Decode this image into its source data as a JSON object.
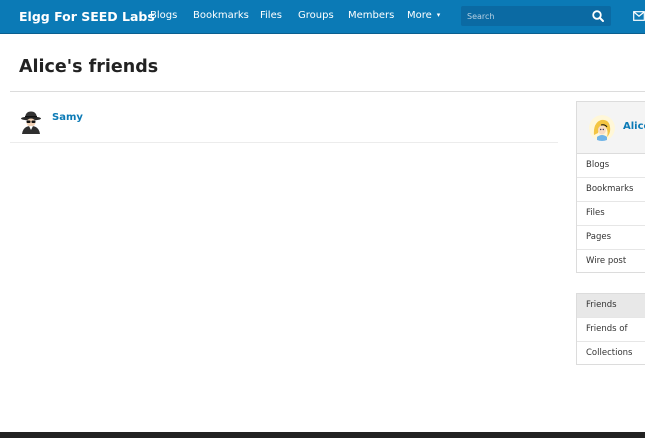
{
  "header": {
    "brand": "Elgg For SEED Labs",
    "nav": [
      "Blogs",
      "Bookmarks",
      "Files",
      "Groups",
      "Members",
      "More"
    ],
    "search_placeholder": "Search",
    "icons": {
      "search": "search-icon",
      "mail": "mail-icon",
      "more": "caret-down-icon"
    }
  },
  "page": {
    "title": "Alice's friends"
  },
  "friends": [
    {
      "name": "Samy",
      "avatar": "spy-avatar"
    }
  ],
  "sidebar": {
    "owner_name": "Alice",
    "owner_avatar": "alice-avatar",
    "owner_links": [
      "Blogs",
      "Bookmarks",
      "Files",
      "Pages",
      "Wire post"
    ],
    "friend_links": [
      {
        "label": "Friends",
        "active": true
      },
      {
        "label": "Friends of",
        "active": false
      },
      {
        "label": "Collections",
        "active": false
      }
    ]
  },
  "colors": {
    "brand_blue": "#0b7ab6",
    "link": "#0b7ab6",
    "footer": "#222222"
  }
}
